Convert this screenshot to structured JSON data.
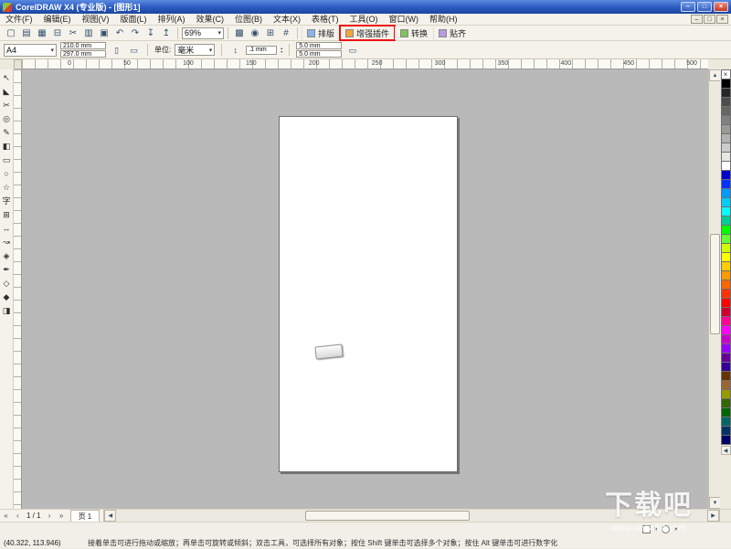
{
  "window": {
    "title": "CorelDRAW X4 (专业版) - [图形1]",
    "controls": {
      "minimize": "–",
      "maximize": "□",
      "close": "×"
    }
  },
  "menubar": {
    "items": [
      "文件(F)",
      "编辑(E)",
      "视图(V)",
      "版面(L)",
      "排列(A)",
      "效果(C)",
      "位图(B)",
      "文本(X)",
      "表格(T)",
      "工具(O)",
      "窗口(W)",
      "帮助(H)"
    ],
    "doc_controls": {
      "minimize": "–",
      "restore": "□",
      "close": "×"
    }
  },
  "icons": {
    "chevron_down": "▾",
    "up": "▲",
    "down": "▼",
    "left": "◀",
    "right": "▶",
    "portrait": "▯",
    "landscape": "▭",
    "nudge": "↕",
    "spin_up": "▴",
    "spin_down": "▾"
  },
  "toolbar": {
    "icons": [
      {
        "name": "new-document-icon",
        "glyph": "▢"
      },
      {
        "name": "open-icon",
        "glyph": "▤"
      },
      {
        "name": "save-icon",
        "glyph": "▦"
      },
      {
        "name": "print-icon",
        "glyph": "⊟"
      },
      {
        "name": "cut-icon",
        "glyph": "✂"
      },
      {
        "name": "copy-icon",
        "glyph": "▥"
      },
      {
        "name": "paste-icon",
        "glyph": "▣"
      },
      {
        "name": "undo-icon",
        "glyph": "↶"
      },
      {
        "name": "redo-icon",
        "glyph": "↷"
      },
      {
        "name": "import-icon",
        "glyph": "↧"
      },
      {
        "name": "export-icon",
        "glyph": "↥"
      }
    ],
    "zoom_level": "69%",
    "mid_icons": [
      {
        "name": "application-launcher-icon",
        "glyph": "▩"
      },
      {
        "name": "welcome-screen-icon",
        "glyph": "◉"
      },
      {
        "name": "snap-to-grid-icon",
        "glyph": "⊞"
      },
      {
        "name": "snap-to-guidelines-icon",
        "glyph": "#"
      }
    ],
    "text_buttons": {
      "arrange": "排版",
      "enhance": "增强插件",
      "convert": "转换",
      "snap": "贴齐"
    },
    "highlight_color": "#ee1111"
  },
  "property_bar": {
    "paper_type": "A4",
    "paper_width": "210.0 mm",
    "paper_height": "297.0 mm",
    "units_label": "单位:",
    "units_value": "毫米",
    "nudge_offset": ".1 mm",
    "duplicate_x": "5.0 mm",
    "duplicate_y": "5.0 mm"
  },
  "ruler": {
    "h_numbers": [
      "0",
      "50",
      "100",
      "150",
      "200",
      "250",
      "300",
      "350",
      "400",
      "450",
      "500"
    ]
  },
  "toolbox": {
    "tools": [
      {
        "name": "pick-tool-icon",
        "glyph": "↖"
      },
      {
        "name": "shape-tool-icon",
        "glyph": "◣"
      },
      {
        "name": "crop-tool-icon",
        "glyph": "✂"
      },
      {
        "name": "zoom-tool-icon",
        "glyph": "◎"
      },
      {
        "name": "freehand-tool-icon",
        "glyph": "✎"
      },
      {
        "name": "smart-fill-tool-icon",
        "glyph": "◧"
      },
      {
        "name": "rectangle-tool-icon",
        "glyph": "▭"
      },
      {
        "name": "ellipse-tool-icon",
        "glyph": "○"
      },
      {
        "name": "polygon-tool-icon",
        "glyph": "☆"
      },
      {
        "name": "text-tool-icon",
        "glyph": "字"
      },
      {
        "name": "table-tool-icon",
        "glyph": "⊞"
      },
      {
        "name": "dimension-tool-icon",
        "glyph": "↔"
      },
      {
        "name": "connector-tool-icon",
        "glyph": "↝"
      },
      {
        "name": "blend-tool-icon",
        "glyph": "◈"
      },
      {
        "name": "eyedropper-tool-icon",
        "glyph": "✒"
      },
      {
        "name": "outline-tool-icon",
        "glyph": "◇"
      },
      {
        "name": "fill-tool-icon",
        "glyph": "◆"
      },
      {
        "name": "interactive-fill-tool-icon",
        "glyph": "◨"
      }
    ]
  },
  "canvas": {
    "widget_text": ""
  },
  "palette": {
    "none_glyph": "×",
    "colors": [
      "#000000",
      "#262626",
      "#4D4D4D",
      "#666666",
      "#808080",
      "#999999",
      "#B3B3B3",
      "#CCCCCC",
      "#E6E6E6",
      "#FFFFFF",
      "#0000CC",
      "#0033FF",
      "#0099FF",
      "#00CCFF",
      "#00FFFF",
      "#00CC99",
      "#00FF00",
      "#66FF33",
      "#CCFF00",
      "#FFFF00",
      "#FFCC00",
      "#FF9900",
      "#FF6600",
      "#FF3300",
      "#FF0000",
      "#CC0033",
      "#FF0099",
      "#FF00FF",
      "#CC00CC",
      "#9900FF",
      "#660099",
      "#330099",
      "#663300",
      "#996633",
      "#999900",
      "#336600",
      "#006600",
      "#006666",
      "#003366",
      "#000066"
    ]
  },
  "page_nav": {
    "first": "«",
    "prev": "‹",
    "label": "1 / 1",
    "next": "›",
    "last": "»",
    "tab": "页 1"
  },
  "statusbar": {
    "coords": "(40.322, 113.946)",
    "hint": "接着单击可进行拖动或缩放；再单击可旋转或倾斜；双击工具，可选择所有对象；按住 Shift 键单击可选择多个对象；按住 Alt 键单击可进行数字化",
    "fill_none": "×",
    "outline_none": "×"
  },
  "watermark": {
    "title": "下载吧",
    "url": "www.xiazaiba.com"
  }
}
